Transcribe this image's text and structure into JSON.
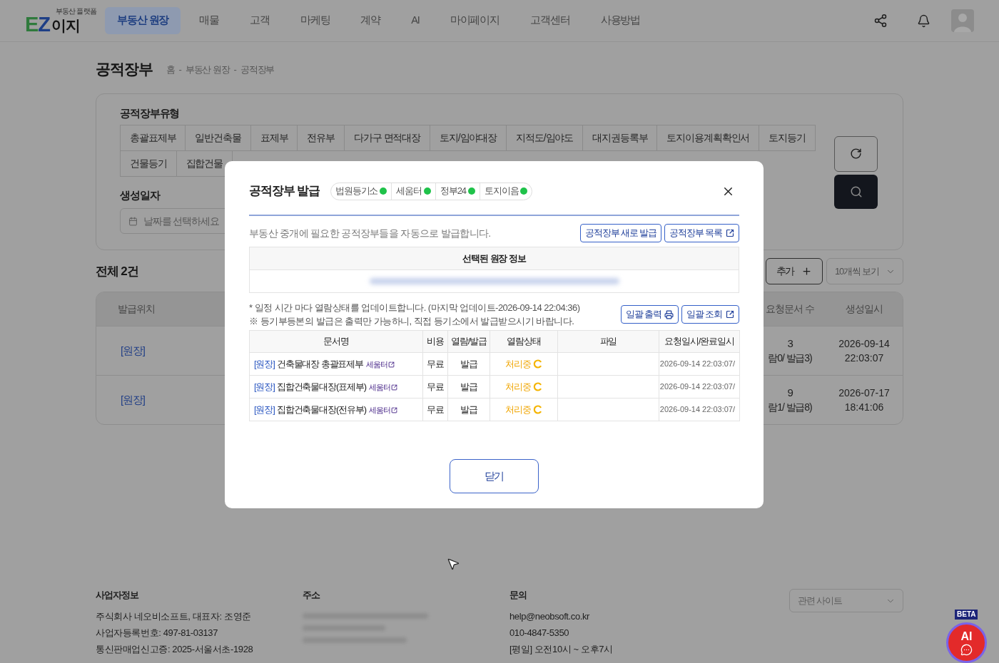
{
  "header": {
    "logo": {
      "mark": "EZ",
      "tagline": "부동산 플랫폼",
      "name": "이지"
    },
    "nav": [
      {
        "label": "부동산 원장",
        "selected": true
      },
      {
        "label": "매물",
        "selected": false
      },
      {
        "label": "고객",
        "selected": false
      },
      {
        "label": "마케팅",
        "selected": false
      },
      {
        "label": "계약",
        "selected": false
      },
      {
        "label": "AI",
        "selected": false
      },
      {
        "label": "마이페이지",
        "selected": false
      },
      {
        "label": "고객센터",
        "selected": false
      },
      {
        "label": "사용방법",
        "selected": false
      }
    ]
  },
  "page": {
    "title": "공적장부",
    "breadcrumb": {
      "items": [
        "홈",
        "부동산 원장",
        "공적장부"
      ],
      "separator": "-"
    }
  },
  "filter": {
    "type_label": "공적장부유형",
    "types": [
      {
        "label": "총괄표제부",
        "selected": false
      },
      {
        "label": "일반건축물",
        "selected": false
      },
      {
        "label": "표제부",
        "selected": false
      },
      {
        "label": "전유부",
        "selected": false
      },
      {
        "label": "다가구 면적대장",
        "selected": false
      },
      {
        "label": "토지/임야대장",
        "selected": false
      },
      {
        "label": "지적도/임야도",
        "selected": false
      },
      {
        "label": "대지권등록부",
        "selected": false
      },
      {
        "label": "토지이용계획확인서",
        "selected": false
      },
      {
        "label": "토지등기",
        "selected": false
      },
      {
        "label": "건물등기",
        "selected": false
      },
      {
        "label": "집합건물",
        "selected": false
      }
    ],
    "date_label": "생성일자",
    "date_field": {
      "placeholder": "날짜를 선택하세요"
    }
  },
  "list": {
    "total": "전체 2건",
    "add_button": "추가",
    "page_size": "10개씩 보기",
    "columns": {
      "location": "발급위치",
      "count": "요청문서 수",
      "created": "생성일시"
    },
    "rows": [
      {
        "location": "[원장]",
        "count": "3",
        "breakdown": "람0/ 발급3)",
        "created_date": "2026-09-14",
        "created_time": "22:03:07"
      },
      {
        "location": "[원장]",
        "count": "9",
        "breakdown": "람1/ 발급8)",
        "created_date": "2026-07-17",
        "created_time": "18:41:06"
      }
    ]
  },
  "dialog": {
    "title": "공적장부 발급",
    "services": [
      {
        "name": "법원등기소",
        "connected": true
      },
      {
        "name": "세움터",
        "connected": true
      },
      {
        "name": "정부24",
        "connected": true
      },
      {
        "name": "토지이음",
        "connected": true
      }
    ],
    "description": "부동산 중개에 필요한 공적장부들을 자동으로 발급합니다.",
    "actions": [
      {
        "label": "공적장부 새로 발급",
        "external": false
      },
      {
        "label": "공적장부 목록",
        "external": true
      }
    ],
    "selected_info": {
      "heading": "선택된 원장 정보",
      "redacted": true
    },
    "notes": [
      "* 일정 시간 마다 열람상태를 업데이트합니다. (마지막 업데이트-2026-09-14 22:04:36)",
      "※ 등기부등본의 발급은 출력만 가능하니, 직접 등기소에서 발급받으시기 바랍니다."
    ],
    "bulk_actions": [
      {
        "label": "일괄 출력",
        "kind": "print"
      },
      {
        "label": "일괄 조회",
        "kind": "external"
      }
    ],
    "table": {
      "columns": [
        "문서명",
        "비용",
        "열람/발급",
        "열람상태",
        "파일",
        "요청일시/완료일시"
      ],
      "rows": [
        {
          "tag": "[원장]",
          "name": "건축물대장 총괄표제부",
          "source": "세움터",
          "cost": "무료",
          "action": "발급",
          "status": {
            "label": "처리중",
            "kind": "processing"
          },
          "requested": "2026-09-14 22:03:07/"
        },
        {
          "tag": "[원장]",
          "name": "집합건축물대장(표제부)",
          "source": "세움터",
          "cost": "무료",
          "action": "발급",
          "status": {
            "label": "처리중",
            "kind": "processing"
          },
          "requested": "2026-09-14 22:03:07/"
        },
        {
          "tag": "[원장]",
          "name": "집합건축물대장(전유부)",
          "source": "세움터",
          "cost": "무료",
          "action": "발급",
          "status": {
            "label": "처리중",
            "kind": "processing"
          },
          "requested": "2026-09-14 22:03:07/"
        }
      ]
    },
    "close_button": "닫기"
  },
  "footer": {
    "sections": [
      {
        "heading": "사업자정보",
        "redacted": false,
        "lines": [
          "주식회사 네오비소프트, 대표자: 조영준",
          "사업자등록번호: 497-81-03137",
          "통신판매업신고증: 2025-서울서초-1928"
        ]
      },
      {
        "heading": "주소",
        "redacted": true
      },
      {
        "heading": "문의",
        "redacted": false,
        "lines": [
          "help@neobsoft.co.kr",
          "010-4847-5350",
          "[평일] 오전10시 ~ 오후7시"
        ]
      }
    ],
    "related_sites": "관련 사이트"
  },
  "chat_widget": {
    "badge": "BETA",
    "label": "AI"
  }
}
